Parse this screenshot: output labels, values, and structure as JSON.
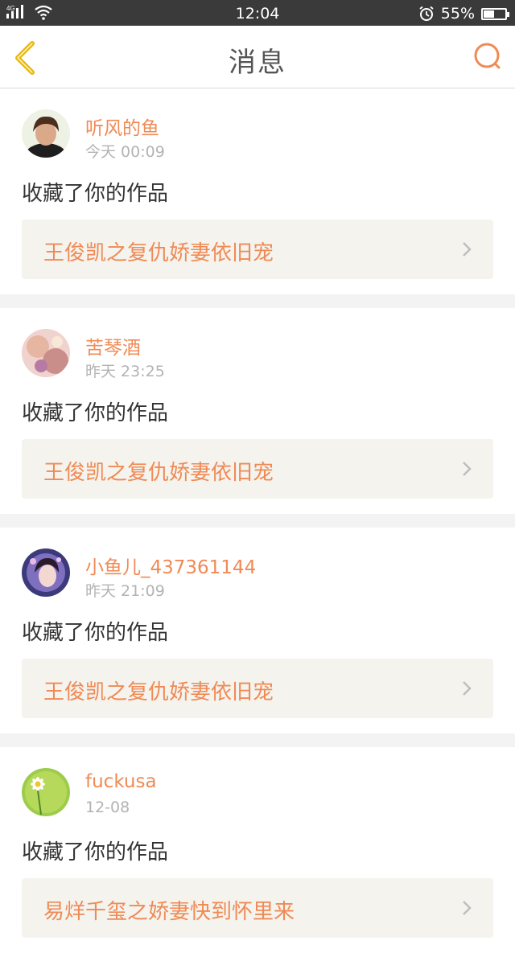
{
  "status_bar": {
    "network": "4G",
    "time": "12:04",
    "battery_percent": "55%",
    "battery_level": 0.55,
    "icons": [
      "signal-icon",
      "wifi-icon",
      "alarm-icon",
      "battery-icon"
    ]
  },
  "header": {
    "title": "消息",
    "back_icon": "back-chevron-icon",
    "search_icon": "search-icon"
  },
  "colors": {
    "accent": "#f08a55",
    "back_arrow": "#e9b60a",
    "card_link_bg": "#f4f3ee",
    "page_bg": "#f3f3f3"
  },
  "messages": [
    {
      "username": "听风的鱼",
      "time": "今天 00:09",
      "action": "收藏了你的作品",
      "work_title": "王俊凯之复仇娇妻依旧宠"
    },
    {
      "username": "苦琴酒",
      "time": "昨天 23:25",
      "action": "收藏了你的作品",
      "work_title": "王俊凯之复仇娇妻依旧宠"
    },
    {
      "username": "小鱼儿_437361144",
      "time": "昨天 21:09",
      "action": "收藏了你的作品",
      "work_title": "王俊凯之复仇娇妻依旧宠"
    },
    {
      "username": "fuckusa",
      "time": "12-08",
      "action": "收藏了你的作品",
      "work_title": "易烊千玺之娇妻快到怀里来"
    }
  ]
}
